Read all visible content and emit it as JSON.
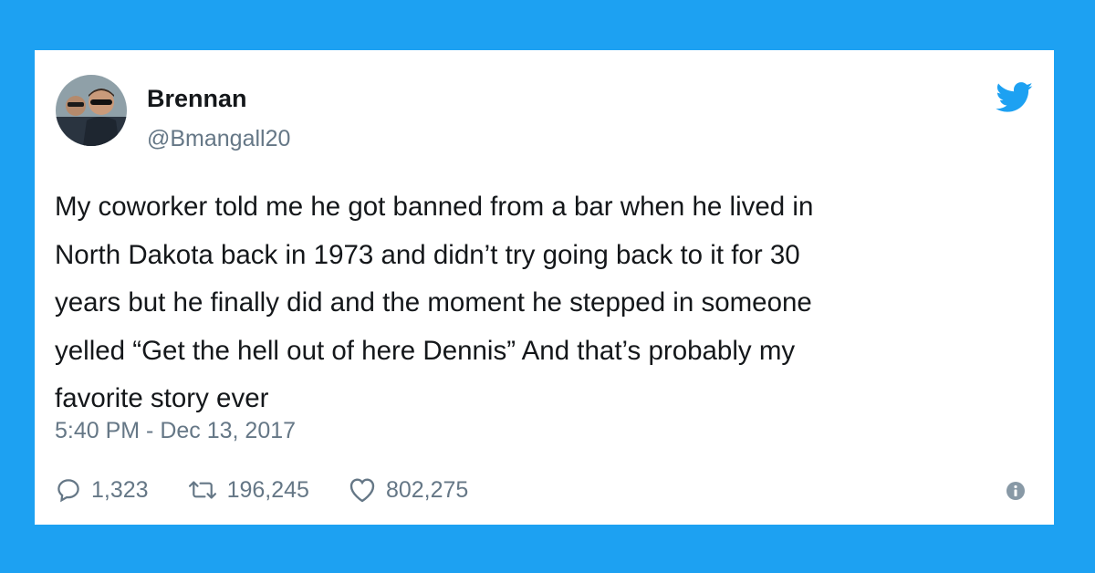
{
  "user": {
    "name": "Brennan",
    "handle": "@Bmangall20"
  },
  "tweet": {
    "text": "My coworker told me he got banned from a bar when he lived in\nNorth Dakota back in 1973 and didn’t try going back to it for 30\nyears but he finally did and the moment he stepped in someone\nyelled “Get the hell out of here Dennis” And that’s probably my\nfavorite story ever",
    "timestamp": "5:40 PM - Dec 13, 2017"
  },
  "actions": {
    "reply_count": "1,323",
    "retweet_count": "196,245",
    "like_count": "802,275"
  },
  "icons": {
    "brand": "twitter-bird-icon",
    "reply": "reply-icon",
    "retweet": "retweet-icon",
    "like": "heart-icon",
    "info": "info-icon"
  },
  "colors": {
    "background": "#1da1f2",
    "card": "#ffffff",
    "text": "#14171a",
    "secondary": "#657786",
    "brand": "#1da1f2"
  }
}
